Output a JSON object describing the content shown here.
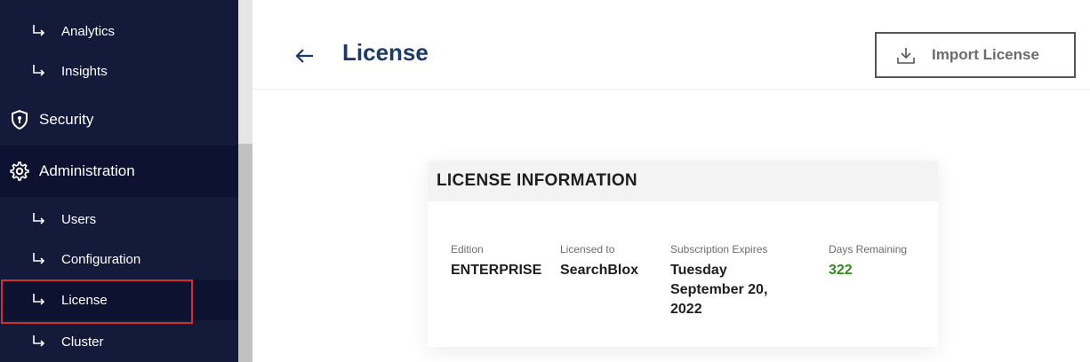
{
  "sidebar": {
    "items": [
      {
        "label": "Analytics",
        "icon": "subitem-arrow-icon"
      },
      {
        "label": "Insights",
        "icon": "subitem-arrow-icon"
      },
      {
        "label": "Security",
        "icon": "shield-icon"
      },
      {
        "label": "Administration",
        "icon": "gear-icon"
      },
      {
        "label": "Users",
        "icon": "subitem-arrow-icon"
      },
      {
        "label": "Configuration",
        "icon": "subitem-arrow-icon"
      },
      {
        "label": "License",
        "icon": "subitem-arrow-icon"
      },
      {
        "label": "Cluster",
        "icon": "subitem-arrow-icon"
      }
    ],
    "active": "License"
  },
  "header": {
    "title": "License",
    "import_label": "Import License"
  },
  "card": {
    "title": "LICENSE INFORMATION",
    "fields": [
      {
        "label": "Edition",
        "value": "ENTERPRISE"
      },
      {
        "label": "Licensed to",
        "value": "SearchBlox"
      },
      {
        "label": "Subscription Expires",
        "value_line1": "Tuesday",
        "value_line2": "September 20,",
        "value_line3": "2022"
      },
      {
        "label": "Days Remaining",
        "value": "322"
      }
    ]
  },
  "colors": {
    "sidebar_bg": "#141a3a",
    "title_blue": "#1b3a6b",
    "active_outline": "#d32f2f",
    "days_green": "#2e8b1e"
  }
}
